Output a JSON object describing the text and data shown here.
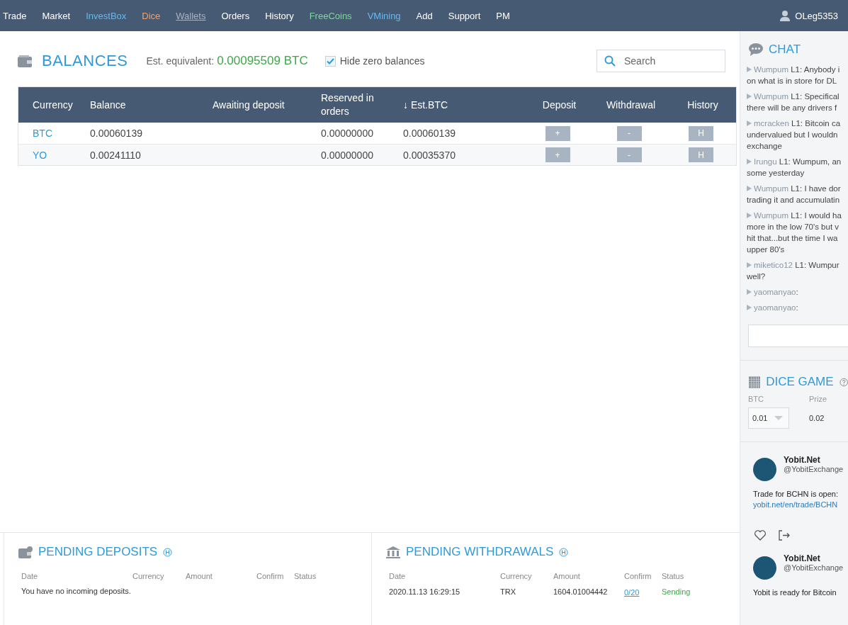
{
  "nav": {
    "items": [
      {
        "label": "Trade",
        "color": "#ffffff",
        "selected": false
      },
      {
        "label": "Market",
        "color": "#ffffff",
        "selected": false
      },
      {
        "label": "InvestBox",
        "color": "#6ab8ec",
        "selected": false
      },
      {
        "label": "Dice",
        "color": "#f0a070",
        "selected": false
      },
      {
        "label": "Wallets",
        "color": "#a9b4c2",
        "selected": true
      },
      {
        "label": "Orders",
        "color": "#ffffff",
        "selected": false
      },
      {
        "label": "History",
        "color": "#ffffff",
        "selected": false
      },
      {
        "label": "FreeCoins",
        "color": "#7fd4a0",
        "selected": false
      },
      {
        "label": "VMining",
        "color": "#6ab8ec",
        "selected": false
      },
      {
        "label": "Add",
        "color": "#ffffff",
        "selected": false
      },
      {
        "label": "Support",
        "color": "#ffffff",
        "selected": false
      },
      {
        "label": "PM",
        "color": "#ffffff",
        "selected": false
      }
    ],
    "user": "OLeg5353"
  },
  "balances": {
    "title": "BALANCES",
    "equivalent_label": "Est. equivalent:",
    "equivalent_value": "0.00095509 BTC",
    "hide_zero": {
      "label": "Hide zero balances",
      "checked": true
    },
    "search": {
      "placeholder": "Search"
    },
    "columns": [
      "Currency",
      "Balance",
      "Awaiting deposit",
      "Reserved in orders",
      "Est.BTC",
      "Deposit",
      "Withdrawal",
      "History"
    ],
    "sort_indicator": "↓",
    "rows": [
      {
        "currency": "BTC",
        "balance": "0.00060139",
        "awaiting": "",
        "reserved": "0.00000000",
        "est_btc": "0.00060139",
        "deposit": "+",
        "withdrawal": "-",
        "history": "H"
      },
      {
        "currency": "YO",
        "balance": "0.00241110",
        "awaiting": "",
        "reserved": "0.00000000",
        "est_btc": "0.00035370",
        "deposit": "+",
        "withdrawal": "-",
        "history": "H"
      }
    ]
  },
  "pending_deposits": {
    "title": "PENDING DEPOSITS",
    "columns": [
      "Date",
      "Currency",
      "Amount",
      "Confirm",
      "Status"
    ],
    "empty": "You have no incoming deposits."
  },
  "pending_withdrawals": {
    "title": "PENDING WITHDRAWALS",
    "columns": [
      "Date",
      "Currency",
      "Amount",
      "Confirm",
      "Status"
    ],
    "rows": [
      {
        "date": "2020.11.13 16:29:15",
        "currency": "TRX",
        "amount": "1604.01004442",
        "confirm": "0/20",
        "status": "Sending"
      }
    ]
  },
  "chat": {
    "title": "CHAT",
    "messages": [
      {
        "user": "Wumpum",
        "lines": [
          "L1: Anybody i",
          "on what is in store for DL"
        ]
      },
      {
        "user": "Wumpum",
        "lines": [
          "L1: Specifical",
          "there will be any drivers f"
        ]
      },
      {
        "user": "mcracken",
        "lines": [
          "L1: Bitcoin ca",
          "undervalued but I wouldn",
          "exchange"
        ]
      },
      {
        "user": "Irungu",
        "lines": [
          "L1: Wumpum, an",
          "some yesterday"
        ]
      },
      {
        "user": "Wumpum",
        "lines": [
          "L1: I have dor",
          "trading it and accumulatin"
        ]
      },
      {
        "user": "Wumpum",
        "lines": [
          "L1: I would ha",
          "more in the low 70's but v",
          "hit that...but the time I wa",
          "upper 80's"
        ]
      },
      {
        "user": "miketico12",
        "lines": [
          "L1: Wumpur",
          "well?"
        ]
      },
      {
        "user": "yaomanyao",
        "lines": [
          ":"
        ]
      },
      {
        "user": "yaomanyao",
        "lines": [
          ":"
        ]
      }
    ]
  },
  "dice": {
    "title": "DICE GAME",
    "bet_label": "BTC",
    "prize_label": "Prize",
    "bet": "0.01",
    "prize": "0.02"
  },
  "tweets": [
    {
      "name": "Yobit.Net",
      "handle": "@YobitExchange",
      "text": "Trade for BCHN is open:",
      "link": "yobit.net/en/trade/BCHN"
    },
    {
      "name": "Yobit.Net",
      "handle": "@YobitExchange",
      "text": "Yobit is ready for Bitcoin"
    }
  ]
}
